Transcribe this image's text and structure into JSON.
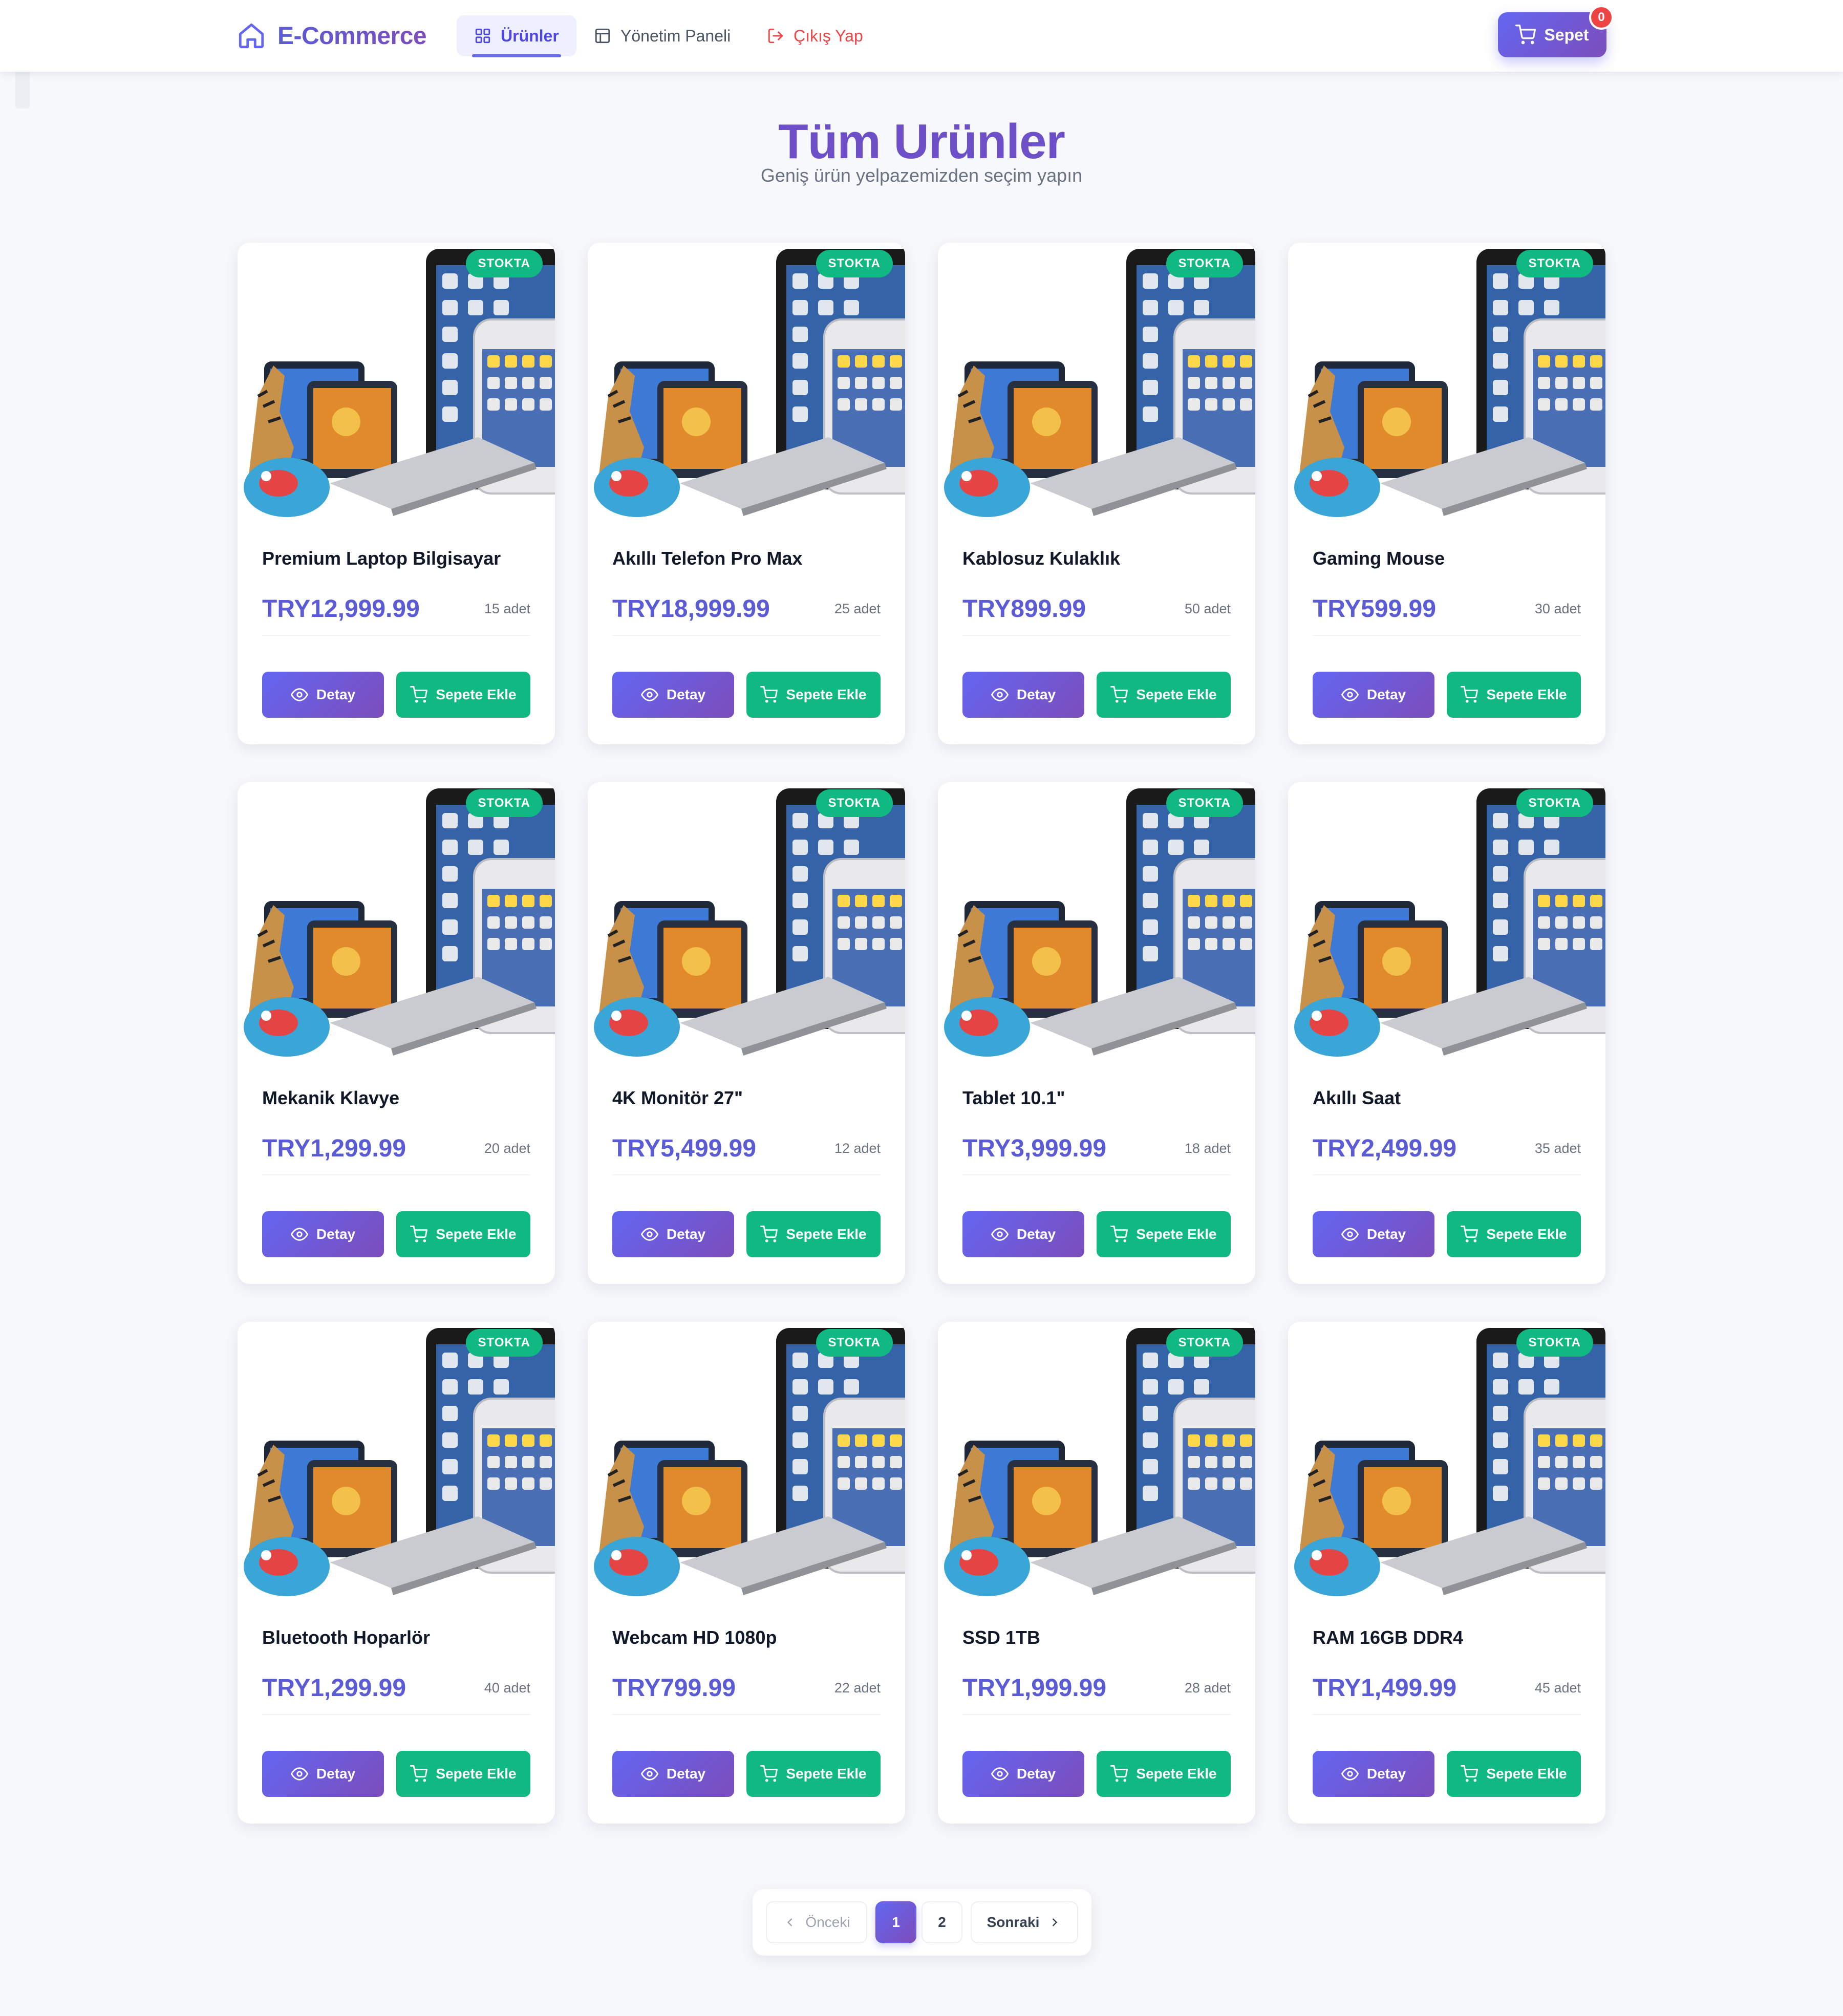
{
  "nav": {
    "brand": "E-Commerce",
    "items": [
      {
        "label": "Ürünler"
      },
      {
        "label": "Yönetim Paneli"
      },
      {
        "label": "Çıkış Yap"
      }
    ],
    "cart_label": "Sepet",
    "cart_count": "0"
  },
  "header": {
    "title": "Tüm Urünler",
    "subtitle": "Geniş ürün yelpazemizden seçim yapın"
  },
  "labels": {
    "stock_badge": "STOKTA",
    "detail_button": "Detay",
    "add_button": "Sepete Ekle"
  },
  "products": [
    {
      "name": "Premium Laptop Bilgisayar",
      "price": "TRY12,999.99",
      "qty": "15 adet"
    },
    {
      "name": "Akıllı Telefon Pro Max",
      "price": "TRY18,999.99",
      "qty": "25 adet"
    },
    {
      "name": "Kablosuz Kulaklık",
      "price": "TRY899.99",
      "qty": "50 adet"
    },
    {
      "name": "Gaming Mouse",
      "price": "TRY599.99",
      "qty": "30 adet"
    },
    {
      "name": "Mekanik Klavye",
      "price": "TRY1,299.99",
      "qty": "20 adet"
    },
    {
      "name": "4K Monitör 27\"",
      "price": "TRY5,499.99",
      "qty": "12 adet"
    },
    {
      "name": "Tablet 10.1\"",
      "price": "TRY3,999.99",
      "qty": "18 adet"
    },
    {
      "name": "Akıllı Saat",
      "price": "TRY2,499.99",
      "qty": "35 adet"
    },
    {
      "name": "Bluetooth Hoparlör",
      "price": "TRY1,299.99",
      "qty": "40 adet"
    },
    {
      "name": "Webcam HD 1080p",
      "price": "TRY799.99",
      "qty": "22 adet"
    },
    {
      "name": "SSD 1TB",
      "price": "TRY1,999.99",
      "qty": "28 adet"
    },
    {
      "name": "RAM 16GB DDR4",
      "price": "TRY1,499.99",
      "qty": "45 adet"
    }
  ],
  "pagination": {
    "prev": "Önceki",
    "pages": [
      "1",
      "2"
    ],
    "current": "1",
    "next": "Sonraki"
  },
  "colors": {
    "primary": "#6366f1",
    "primary_dark": "#7c4dbb",
    "success": "#10b981",
    "danger": "#ef4444"
  }
}
